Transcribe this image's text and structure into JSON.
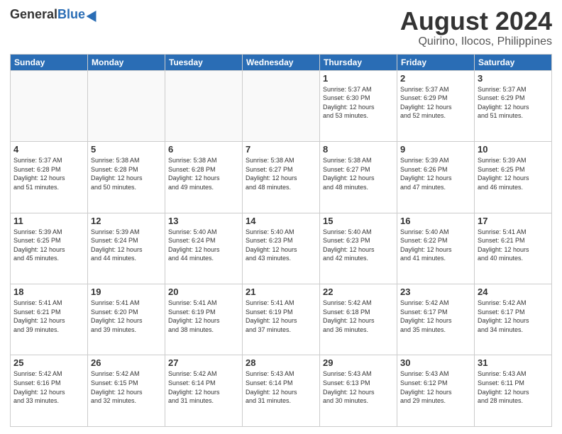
{
  "logo": {
    "general": "General",
    "blue": "Blue"
  },
  "title": "August 2024",
  "location": "Quirino, Ilocos, Philippines",
  "days_of_week": [
    "Sunday",
    "Monday",
    "Tuesday",
    "Wednesday",
    "Thursday",
    "Friday",
    "Saturday"
  ],
  "weeks": [
    [
      {
        "day": "",
        "info": ""
      },
      {
        "day": "",
        "info": ""
      },
      {
        "day": "",
        "info": ""
      },
      {
        "day": "",
        "info": ""
      },
      {
        "day": "1",
        "info": "Sunrise: 5:37 AM\nSunset: 6:30 PM\nDaylight: 12 hours\nand 53 minutes."
      },
      {
        "day": "2",
        "info": "Sunrise: 5:37 AM\nSunset: 6:29 PM\nDaylight: 12 hours\nand 52 minutes."
      },
      {
        "day": "3",
        "info": "Sunrise: 5:37 AM\nSunset: 6:29 PM\nDaylight: 12 hours\nand 51 minutes."
      }
    ],
    [
      {
        "day": "4",
        "info": "Sunrise: 5:37 AM\nSunset: 6:28 PM\nDaylight: 12 hours\nand 51 minutes."
      },
      {
        "day": "5",
        "info": "Sunrise: 5:38 AM\nSunset: 6:28 PM\nDaylight: 12 hours\nand 50 minutes."
      },
      {
        "day": "6",
        "info": "Sunrise: 5:38 AM\nSunset: 6:28 PM\nDaylight: 12 hours\nand 49 minutes."
      },
      {
        "day": "7",
        "info": "Sunrise: 5:38 AM\nSunset: 6:27 PM\nDaylight: 12 hours\nand 48 minutes."
      },
      {
        "day": "8",
        "info": "Sunrise: 5:38 AM\nSunset: 6:27 PM\nDaylight: 12 hours\nand 48 minutes."
      },
      {
        "day": "9",
        "info": "Sunrise: 5:39 AM\nSunset: 6:26 PM\nDaylight: 12 hours\nand 47 minutes."
      },
      {
        "day": "10",
        "info": "Sunrise: 5:39 AM\nSunset: 6:25 PM\nDaylight: 12 hours\nand 46 minutes."
      }
    ],
    [
      {
        "day": "11",
        "info": "Sunrise: 5:39 AM\nSunset: 6:25 PM\nDaylight: 12 hours\nand 45 minutes."
      },
      {
        "day": "12",
        "info": "Sunrise: 5:39 AM\nSunset: 6:24 PM\nDaylight: 12 hours\nand 44 minutes."
      },
      {
        "day": "13",
        "info": "Sunrise: 5:40 AM\nSunset: 6:24 PM\nDaylight: 12 hours\nand 44 minutes."
      },
      {
        "day": "14",
        "info": "Sunrise: 5:40 AM\nSunset: 6:23 PM\nDaylight: 12 hours\nand 43 minutes."
      },
      {
        "day": "15",
        "info": "Sunrise: 5:40 AM\nSunset: 6:23 PM\nDaylight: 12 hours\nand 42 minutes."
      },
      {
        "day": "16",
        "info": "Sunrise: 5:40 AM\nSunset: 6:22 PM\nDaylight: 12 hours\nand 41 minutes."
      },
      {
        "day": "17",
        "info": "Sunrise: 5:41 AM\nSunset: 6:21 PM\nDaylight: 12 hours\nand 40 minutes."
      }
    ],
    [
      {
        "day": "18",
        "info": "Sunrise: 5:41 AM\nSunset: 6:21 PM\nDaylight: 12 hours\nand 39 minutes."
      },
      {
        "day": "19",
        "info": "Sunrise: 5:41 AM\nSunset: 6:20 PM\nDaylight: 12 hours\nand 39 minutes."
      },
      {
        "day": "20",
        "info": "Sunrise: 5:41 AM\nSunset: 6:19 PM\nDaylight: 12 hours\nand 38 minutes."
      },
      {
        "day": "21",
        "info": "Sunrise: 5:41 AM\nSunset: 6:19 PM\nDaylight: 12 hours\nand 37 minutes."
      },
      {
        "day": "22",
        "info": "Sunrise: 5:42 AM\nSunset: 6:18 PM\nDaylight: 12 hours\nand 36 minutes."
      },
      {
        "day": "23",
        "info": "Sunrise: 5:42 AM\nSunset: 6:17 PM\nDaylight: 12 hours\nand 35 minutes."
      },
      {
        "day": "24",
        "info": "Sunrise: 5:42 AM\nSunset: 6:17 PM\nDaylight: 12 hours\nand 34 minutes."
      }
    ],
    [
      {
        "day": "25",
        "info": "Sunrise: 5:42 AM\nSunset: 6:16 PM\nDaylight: 12 hours\nand 33 minutes."
      },
      {
        "day": "26",
        "info": "Sunrise: 5:42 AM\nSunset: 6:15 PM\nDaylight: 12 hours\nand 32 minutes."
      },
      {
        "day": "27",
        "info": "Sunrise: 5:42 AM\nSunset: 6:14 PM\nDaylight: 12 hours\nand 31 minutes."
      },
      {
        "day": "28",
        "info": "Sunrise: 5:43 AM\nSunset: 6:14 PM\nDaylight: 12 hours\nand 31 minutes."
      },
      {
        "day": "29",
        "info": "Sunrise: 5:43 AM\nSunset: 6:13 PM\nDaylight: 12 hours\nand 30 minutes."
      },
      {
        "day": "30",
        "info": "Sunrise: 5:43 AM\nSunset: 6:12 PM\nDaylight: 12 hours\nand 29 minutes."
      },
      {
        "day": "31",
        "info": "Sunrise: 5:43 AM\nSunset: 6:11 PM\nDaylight: 12 hours\nand 28 minutes."
      }
    ]
  ]
}
